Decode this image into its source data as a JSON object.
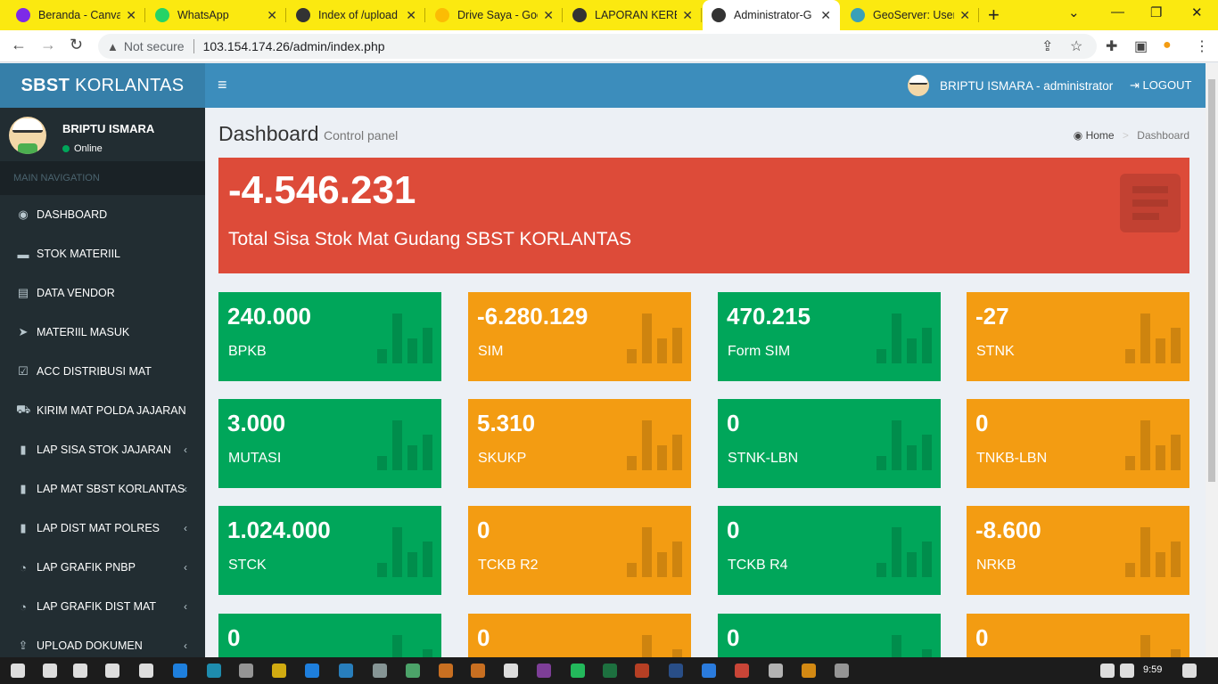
{
  "browser": {
    "tabs": [
      {
        "title": "Beranda - Canva",
        "icon": "canva-icon",
        "color": "#7d2ae8"
      },
      {
        "title": "WhatsApp",
        "icon": "whatsapp-icon",
        "color": "#25d366"
      },
      {
        "title": "Index of /upload",
        "icon": "globe-icon",
        "color": "#333333"
      },
      {
        "title": "Drive Saya - Goo",
        "icon": "drive-icon",
        "color": "#fbbc04"
      },
      {
        "title": "LAPORAN KEREN",
        "icon": "globe-icon",
        "color": "#333333"
      },
      {
        "title": "Administrator-G",
        "icon": "globe-icon",
        "color": "#333333",
        "active": true
      },
      {
        "title": "GeoServer: User I",
        "icon": "geoserver-icon",
        "color": "#3aa0b8"
      }
    ],
    "security_label": "Not secure",
    "url": "103.154.174.26/admin/index.php"
  },
  "app": {
    "logo_bold": "SBST",
    "logo_rest": "KORLANTAS",
    "top_user": "BRIPTU ISMARA - administrator",
    "logout_label": "LOGOUT"
  },
  "sidebar": {
    "user_name": "BRIPTU ISMARA",
    "user_status": "Online",
    "nav_header": "MAIN NAVIGATION",
    "items": [
      {
        "label": "DASHBOARD",
        "icon": "dashboard-icon",
        "glyph": "◉",
        "chev": false
      },
      {
        "label": "STOK MATERIIL",
        "icon": "folder-icon",
        "glyph": "▬",
        "chev": false
      },
      {
        "label": "DATA VENDOR",
        "icon": "vendor-card-icon",
        "glyph": "▤",
        "chev": false
      },
      {
        "label": "MATERIIL MASUK",
        "icon": "send-icon",
        "glyph": "➤",
        "chev": false
      },
      {
        "label": "ACC DISTRIBUSI MAT",
        "icon": "check-square-icon",
        "glyph": "☑",
        "chev": false
      },
      {
        "label": "KIRIM MAT POLDA JAJARAN",
        "icon": "truck-icon",
        "glyph": "⛟",
        "chev": false
      },
      {
        "label": "LAP SISA STOK JAJARAN",
        "icon": "file-icon",
        "glyph": "▮",
        "chev": true
      },
      {
        "label": "LAP MAT SBST KORLANTAS",
        "icon": "file-icon",
        "glyph": "▮",
        "chev": true
      },
      {
        "label": "LAP DIST MAT POLRES",
        "icon": "file-icon",
        "glyph": "▮",
        "chev": true
      },
      {
        "label": "LAP GRAFIK PNBP",
        "icon": "pie-chart-icon",
        "glyph": "◔",
        "chev": true
      },
      {
        "label": "LAP GRAFIK DIST MAT",
        "icon": "pie-chart-icon",
        "glyph": "◔",
        "chev": true
      },
      {
        "label": "UPLOAD DOKUMEN",
        "icon": "upload-icon",
        "glyph": "⇪",
        "chev": true
      }
    ]
  },
  "content": {
    "title": "Dashboard",
    "subtitle": "Control panel",
    "breadcrumb_home": "Home",
    "breadcrumb_current": "Dashboard",
    "total": {
      "value": "-4.546.231",
      "label": "Total Sisa Stok Mat Gudang SBST KORLANTAS",
      "color": "#dd4b39"
    },
    "boxes": [
      {
        "value": "240.000",
        "label": "BPKB",
        "color": "green"
      },
      {
        "value": "-6.280.129",
        "label": "SIM",
        "color": "orange"
      },
      {
        "value": "470.215",
        "label": "Form SIM",
        "color": "green"
      },
      {
        "value": "-27",
        "label": "STNK",
        "color": "orange"
      },
      {
        "value": "3.000",
        "label": "MUTASI",
        "color": "green"
      },
      {
        "value": "5.310",
        "label": "SKUKP",
        "color": "orange"
      },
      {
        "value": "0",
        "label": "STNK-LBN",
        "color": "green"
      },
      {
        "value": "0",
        "label": "TNKB-LBN",
        "color": "orange"
      },
      {
        "value": "1.024.000",
        "label": "STCK",
        "color": "green"
      },
      {
        "value": "0",
        "label": "TCKB R2",
        "color": "orange"
      },
      {
        "value": "0",
        "label": "TCKB R4",
        "color": "green"
      },
      {
        "value": "-8.600",
        "label": "NRKB",
        "color": "orange"
      },
      {
        "value": "0",
        "label": "",
        "color": "green"
      },
      {
        "value": "0",
        "label": "",
        "color": "orange"
      },
      {
        "value": "0",
        "label": "",
        "color": "green"
      },
      {
        "value": "0",
        "label": "",
        "color": "orange"
      }
    ]
  },
  "taskbar": {
    "time": "9:59"
  }
}
